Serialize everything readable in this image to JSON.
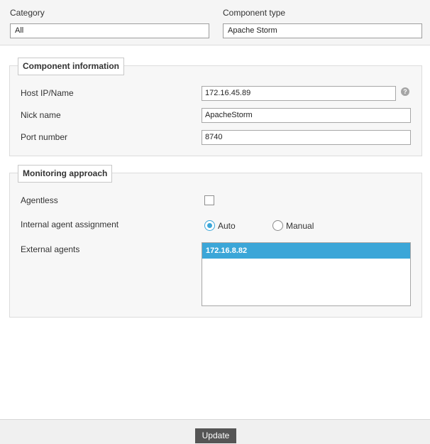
{
  "header": {
    "category": {
      "label": "Category",
      "value": "All"
    },
    "component_type": {
      "label": "Component type",
      "value": "Apache Storm"
    }
  },
  "component_info": {
    "title": "Component information",
    "host": {
      "label": "Host IP/Name",
      "value": "172.16.45.89"
    },
    "nick": {
      "label": "Nick name",
      "value": "ApacheStorm"
    },
    "port": {
      "label": "Port number",
      "value": "8740"
    },
    "help_icon": "question-mark-icon",
    "help_glyph": "?"
  },
  "monitoring": {
    "title": "Monitoring approach",
    "agentless": {
      "label": "Agentless",
      "checked": false
    },
    "internal_agent": {
      "label": "Internal agent assignment",
      "options": [
        "Auto",
        "Manual"
      ],
      "selected": "Auto"
    },
    "external_agents": {
      "label": "External agents",
      "items": [
        "172.16.8.82"
      ],
      "selected": "172.16.8.82"
    }
  },
  "footer": {
    "update_label": "Update"
  },
  "colors": {
    "accent": "#3ba6d8",
    "button": "#555555"
  }
}
